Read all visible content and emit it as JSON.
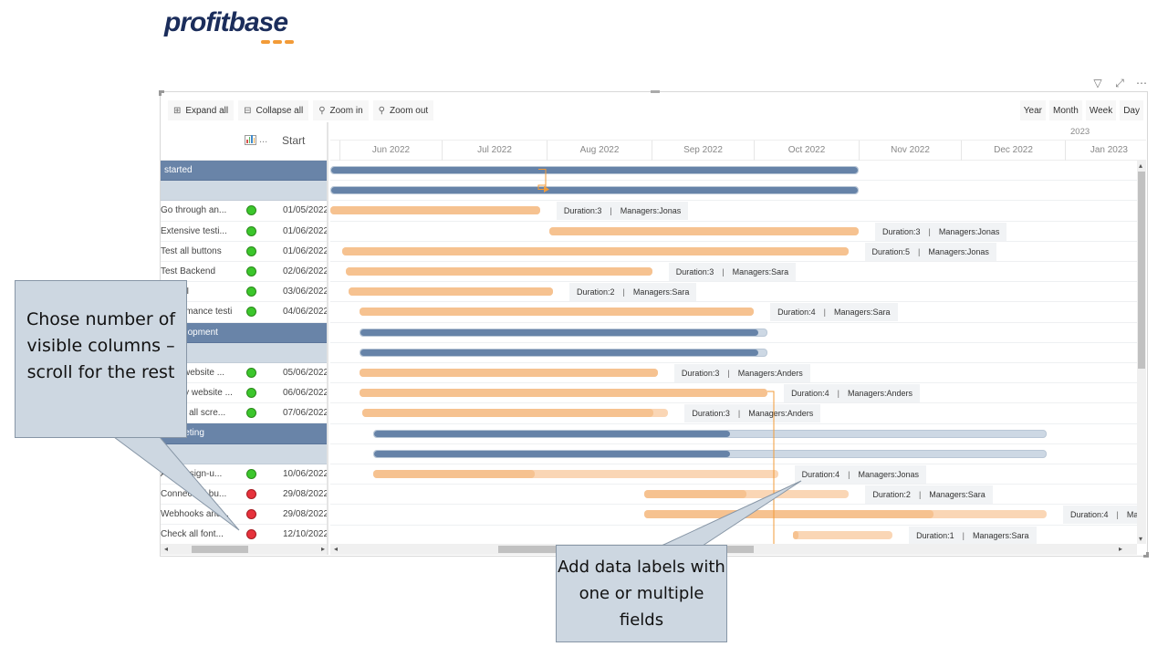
{
  "brand": {
    "name": "profitbase",
    "accent": "#f29b38",
    "color": "#1b2d5b"
  },
  "visual_header_icons": [
    "filter-icon",
    "focus-mode-icon",
    "more-options-icon"
  ],
  "toolbar": {
    "expand_all": "Expand all",
    "collapse_all": "Collapse all",
    "zoom_in": "Zoom in",
    "zoom_out": "Zoom out",
    "scales": [
      "Year",
      "Month",
      "Week",
      "Day"
    ]
  },
  "columns": {
    "status_header": "...",
    "start_header": "Start"
  },
  "timeline": {
    "year_label": "2023",
    "months": [
      "Jun 2022",
      "Jul 2022",
      "Aug 2022",
      "Sep 2022",
      "Oct 2022",
      "Nov 2022",
      "Dec 2022",
      "Jan 2023"
    ]
  },
  "colors": {
    "summary_bar": "#6683a8",
    "summary_remaining": "#cdd8e4",
    "task_bar": "#f6c290",
    "task_remaining": "#fad6b5",
    "status_green": "#3cc62c",
    "status_red": "#e6323c",
    "dependency": "#f29b38"
  },
  "rows": [
    {
      "type": "group",
      "name": "started",
      "status": "",
      "start": "",
      "bar": {
        "kind": "sum",
        "start": 0.0,
        "end": 0.655,
        "progress": 1.0
      },
      "label": ""
    },
    {
      "type": "sub",
      "name": "",
      "status": "",
      "start": "",
      "bar": {
        "kind": "sum",
        "start": 0.0,
        "end": 0.655,
        "progress": 1.0
      },
      "label": ""
    },
    {
      "type": "task",
      "name": "Go through an...",
      "status": "green",
      "start": "01/05/2022",
      "bar": {
        "kind": "task",
        "start": 0.0,
        "end": 0.26,
        "progress": 1.0
      },
      "label": {
        "duration": "Duration:3",
        "managers": "Managers:Jonas"
      }
    },
    {
      "type": "task",
      "name": "Extensive testi...",
      "status": "green",
      "start": "01/06/2022",
      "bar": {
        "kind": "task",
        "start": 0.272,
        "end": 0.655,
        "progress": 1.0
      },
      "label": {
        "duration": "Duration:3",
        "managers": "Managers:Jonas"
      }
    },
    {
      "type": "task",
      "name": "Test all buttons",
      "status": "green",
      "start": "01/06/2022",
      "bar": {
        "kind": "task",
        "start": 0.015,
        "end": 0.642,
        "progress": 1.0
      },
      "label": {
        "duration": "Duration:5",
        "managers": "Managers:Jonas"
      }
    },
    {
      "type": "task",
      "name": "Test Backend",
      "status": "green",
      "start": "02/06/2022",
      "bar": {
        "kind": "task",
        "start": 0.019,
        "end": 0.399,
        "progress": 1.0
      },
      "label": {
        "duration": "Duration:3",
        "managers": "Managers:Sara"
      }
    },
    {
      "type": "task",
      "name": "Test UI",
      "status": "green",
      "start": "03/06/2022",
      "bar": {
        "kind": "task",
        "start": 0.023,
        "end": 0.276,
        "progress": 1.0
      },
      "label": {
        "duration": "Duration:2",
        "managers": "Managers:Sara"
      }
    },
    {
      "type": "task",
      "name": "Performance testing",
      "status": "green",
      "start": "04/06/2022",
      "bar": {
        "kind": "task",
        "start": 0.036,
        "end": 0.525,
        "progress": 1.0
      },
      "label": {
        "duration": "Duration:4",
        "managers": "Managers:Sara"
      }
    },
    {
      "type": "group",
      "name": "Development",
      "status": "",
      "start": "",
      "bar": {
        "kind": "sum",
        "start": 0.036,
        "end": 0.542,
        "progress": 0.98
      },
      "label": ""
    },
    {
      "type": "sub",
      "name": "",
      "status": "",
      "start": "",
      "bar": {
        "kind": "sum",
        "start": 0.036,
        "end": 0.542,
        "progress": 0.98
      },
      "label": ""
    },
    {
      "type": "task",
      "name": "Build website ...",
      "status": "green",
      "start": "05/06/2022",
      "bar": {
        "kind": "task",
        "start": 0.036,
        "end": 0.406,
        "progress": 1.0
      },
      "label": {
        "duration": "Duration:3",
        "managers": "Managers:Anders"
      }
    },
    {
      "type": "task",
      "name": "Deploy website ...",
      "status": "green",
      "start": "06/06/2022",
      "bar": {
        "kind": "task",
        "start": 0.036,
        "end": 0.542,
        "progress": 1.0
      },
      "label": {
        "duration": "Duration:4",
        "managers": "Managers:Anders"
      }
    },
    {
      "type": "task",
      "name": "Check all scre...",
      "status": "green",
      "start": "07/06/2022",
      "bar": {
        "kind": "task",
        "start": 0.04,
        "end": 0.419,
        "progress": 0.95
      },
      "label": {
        "duration": "Duration:3",
        "managers": "Managers:Anders"
      }
    },
    {
      "type": "group",
      "name": "Marketing",
      "status": "",
      "start": "",
      "bar": {
        "kind": "sum",
        "start": 0.053,
        "end": 0.888,
        "progress": 0.53
      },
      "label": ""
    },
    {
      "type": "sub",
      "name": "",
      "status": "",
      "start": "",
      "bar": {
        "kind": "sum",
        "start": 0.053,
        "end": 0.888,
        "progress": 0.53
      },
      "label": ""
    },
    {
      "type": "task",
      "name": "Add design-u...",
      "status": "green",
      "start": "10/06/2022",
      "bar": {
        "kind": "task",
        "start": 0.053,
        "end": 0.555,
        "progress": 0.4
      },
      "label": {
        "duration": "Duration:4",
        "managers": "Managers:Jonas"
      }
    },
    {
      "type": "task",
      "name": "Connect all bu...",
      "status": "red",
      "start": "29/08/2022",
      "bar": {
        "kind": "task",
        "start": 0.389,
        "end": 0.643,
        "progress": 0.5
      },
      "label": {
        "duration": "Duration:2",
        "managers": "Managers:Sara"
      }
    },
    {
      "type": "task",
      "name": "Webhooks and...",
      "status": "red",
      "start": "29/08/2022",
      "bar": {
        "kind": "task",
        "start": 0.389,
        "end": 0.888,
        "progress": 0.72
      },
      "label": {
        "duration": "Duration:4",
        "managers": "Managers:Sara"
      }
    },
    {
      "type": "task",
      "name": "Check all font...",
      "status": "red",
      "start": "12/10/2022",
      "bar": {
        "kind": "task",
        "start": 0.574,
        "end": 0.697,
        "progress": 0.05
      },
      "label": {
        "duration": "Duration:1",
        "managers": "Managers:Sara"
      }
    }
  ],
  "callouts": {
    "columns": "Chose number of visible columns – scroll for the rest",
    "labels": "Add data labels with one or multiple fields"
  }
}
